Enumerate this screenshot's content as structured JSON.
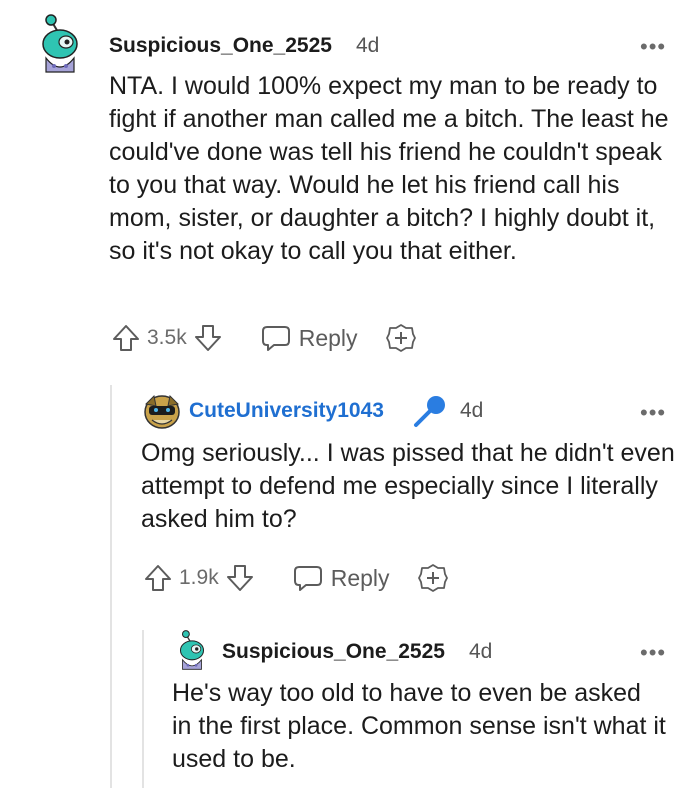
{
  "comments": [
    {
      "username": "Suspicious_One_2525",
      "time": "4d",
      "text": "NTA. I would 100% expect my man to be ready to fight if another man called me a bitch. The least he could've done was tell his friend he couldn't speak to you that way. Would he let his friend call his mom, sister, or daughter a bitch? I highly doubt it, so it's not okay to call you that either.",
      "votes": "3.5k",
      "reply_label": "Reply"
    },
    {
      "username": "CuteUniversity1043",
      "time": "4d",
      "text": "Omg seriously... I was pissed that he didn't even attempt to defend me especially since I literally asked him to?",
      "votes": "1.9k",
      "reply_label": "Reply"
    },
    {
      "username": "Suspicious_One_2525",
      "time": "4d",
      "text": "He's way too old to have to even be asked in the first place. Common sense isn't what it used to be."
    }
  ],
  "more_glyph": "•••",
  "colors": {
    "op_username": "#1f6fd1",
    "mic": "#2a7de1",
    "text": "#1c1c1c",
    "meta": "#6b6b6b"
  },
  "icons": [
    "avatar",
    "upvote-icon",
    "downvote-icon",
    "reply-icon",
    "award-icon",
    "microphone-icon",
    "more-options-icon"
  ]
}
